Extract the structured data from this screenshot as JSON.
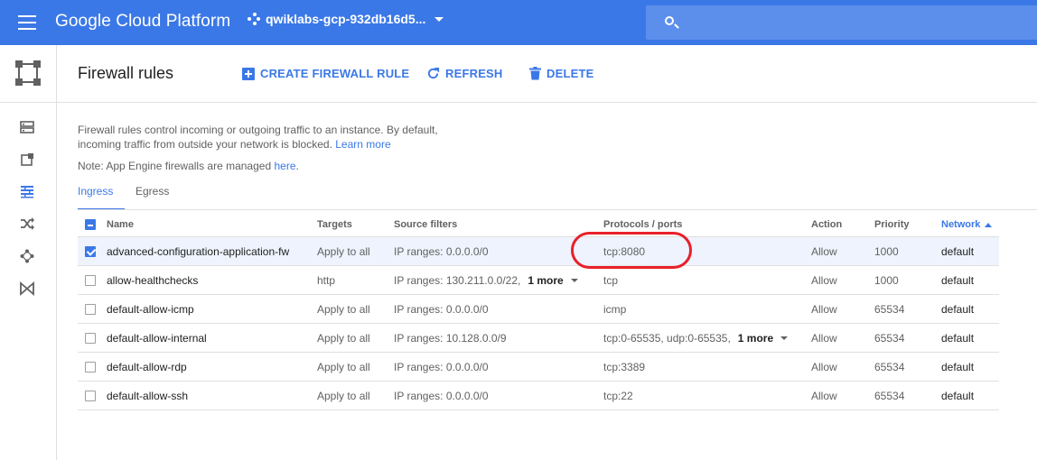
{
  "topbar": {
    "brand": "Google Cloud Platform",
    "project": "qwiklabs-gcp-932db16d5...",
    "search_placeholder": ""
  },
  "colors": {
    "topbar_bg": "#3b78e7",
    "accent": "#3b78e7",
    "annotation": "#e8202a"
  },
  "leftnav": {
    "icons": [
      "vpc-networks-icon",
      "external-ip-icon",
      "firewall-rules-icon",
      "routes-icon",
      "peering-icon",
      "shared-vpc-icon"
    ]
  },
  "header": {
    "title": "Firewall rules",
    "create_label": "CREATE FIREWALL RULE",
    "refresh_label": "REFRESH",
    "delete_label": "DELETE"
  },
  "description": {
    "line1": "Firewall rules control incoming or outgoing traffic to an instance. By default,",
    "line2": "incoming traffic from outside your network is blocked.",
    "learn_more": "Learn more",
    "note_text": "Note: App Engine firewalls are managed ",
    "note_link": "here",
    "note_end": "."
  },
  "tabs": [
    {
      "label": "Ingress",
      "active": true
    },
    {
      "label": "Egress",
      "active": false
    }
  ],
  "table": {
    "columns": {
      "name": "Name",
      "targets": "Targets",
      "source": "Source filters",
      "protocols": "Protocols / ports",
      "action": "Action",
      "priority": "Priority",
      "network": "Network"
    },
    "rows": [
      {
        "name": "advanced-configuration-application-fw",
        "targets": "Apply to all",
        "source": "IP ranges: 0.0.0.0/0",
        "source_more": "",
        "protocols": "tcp:8080",
        "protocols_more": "",
        "action": "Allow",
        "priority": "1000",
        "network": "default",
        "checked": true
      },
      {
        "name": "allow-healthchecks",
        "targets": "http",
        "source": "IP ranges: 130.211.0.0/22,",
        "source_more": "1 more",
        "protocols": "tcp",
        "protocols_more": "",
        "action": "Allow",
        "priority": "1000",
        "network": "default",
        "checked": false
      },
      {
        "name": "default-allow-icmp",
        "targets": "Apply to all",
        "source": "IP ranges: 0.0.0.0/0",
        "source_more": "",
        "protocols": "icmp",
        "protocols_more": "",
        "action": "Allow",
        "priority": "65534",
        "network": "default",
        "checked": false
      },
      {
        "name": "default-allow-internal",
        "targets": "Apply to all",
        "source": "IP ranges: 10.128.0.0/9",
        "source_more": "",
        "protocols": "tcp:0-65535, udp:0-65535,",
        "protocols_more": "1 more",
        "action": "Allow",
        "priority": "65534",
        "network": "default",
        "checked": false
      },
      {
        "name": "default-allow-rdp",
        "targets": "Apply to all",
        "source": "IP ranges: 0.0.0.0/0",
        "source_more": "",
        "protocols": "tcp:3389",
        "protocols_more": "",
        "action": "Allow",
        "priority": "65534",
        "network": "default",
        "checked": false
      },
      {
        "name": "default-allow-ssh",
        "targets": "Apply to all",
        "source": "IP ranges: 0.0.0.0/0",
        "source_more": "",
        "protocols": "tcp:22",
        "protocols_more": "",
        "action": "Allow",
        "priority": "65534",
        "network": "default",
        "checked": false
      }
    ]
  }
}
